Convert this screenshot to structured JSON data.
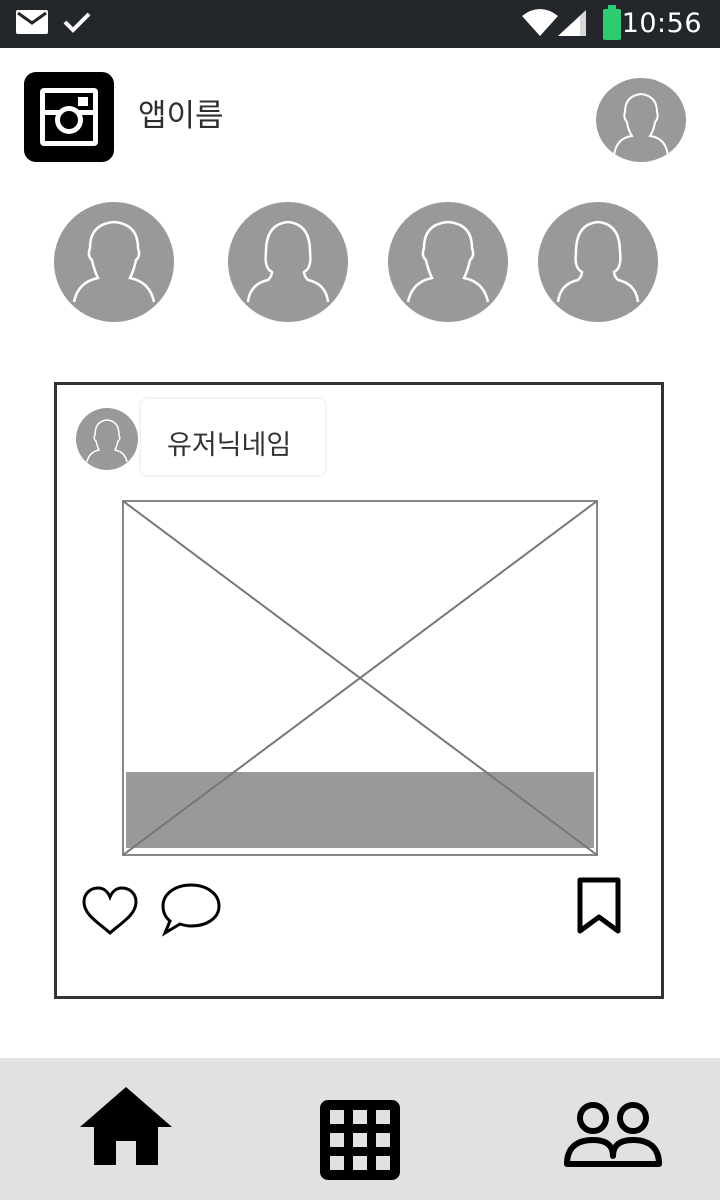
{
  "status_bar": {
    "time": "10:56",
    "left_icons": [
      "mail-icon",
      "check-icon"
    ],
    "right_icons": [
      "wifi-icon",
      "signal-icon",
      "battery-icon"
    ],
    "battery_color": "#2ecc71"
  },
  "header": {
    "app_name": "앱이름",
    "logo_icon": "camera-logo-icon",
    "profile_icon": "user-avatar-icon"
  },
  "stories": {
    "items": [
      {
        "icon": "male-avatar-icon"
      },
      {
        "icon": "female-avatar-icon"
      },
      {
        "icon": "male-avatar-icon"
      },
      {
        "icon": "female-avatar-icon"
      }
    ]
  },
  "post": {
    "nickname": "유저닉네임",
    "image_placeholder": "image-placeholder",
    "actions": {
      "like_icon": "heart-icon",
      "comment_icon": "comment-icon",
      "bookmark_icon": "bookmark-icon"
    }
  },
  "bottom_nav": {
    "items": [
      {
        "icon": "home-icon"
      },
      {
        "icon": "grid-icon"
      },
      {
        "icon": "people-icon"
      }
    ]
  },
  "colors": {
    "status_bar": "#23272b",
    "avatar_bg": "#999999",
    "card_border": "#333333",
    "nav_bg": "#e1e1e1"
  }
}
